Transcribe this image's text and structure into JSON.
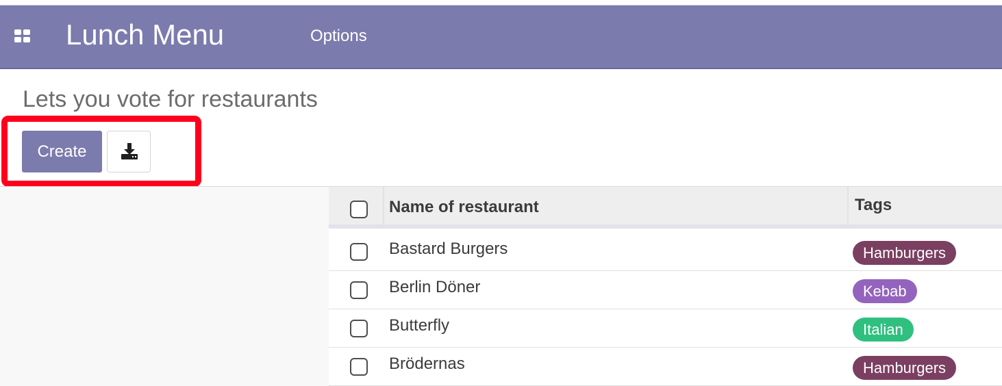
{
  "navbar": {
    "apps_icon": "apps-grid-icon",
    "brand": "Lunch Menu",
    "menu_options": "Options",
    "color": "#7c7bad"
  },
  "page": {
    "subtitle": "Lets you vote for restaurants"
  },
  "toolbar": {
    "create_label": "Create",
    "download_icon": "download-icon",
    "highlight_color": "#ff001c"
  },
  "table": {
    "headers": {
      "name": "Name of restaurant",
      "tags": "Tags"
    },
    "rows": [
      {
        "name": "Bastard Burgers",
        "tag": "Hamburgers",
        "tag_color": "#7b3f61"
      },
      {
        "name": "Berlin Döner",
        "tag": "Kebab",
        "tag_color": "#9363bd"
      },
      {
        "name": "Butterfly",
        "tag": "Italian",
        "tag_color": "#2fc07f"
      },
      {
        "name": "Brödernas",
        "tag": "Hamburgers",
        "tag_color": "#7b3f61"
      }
    ]
  }
}
